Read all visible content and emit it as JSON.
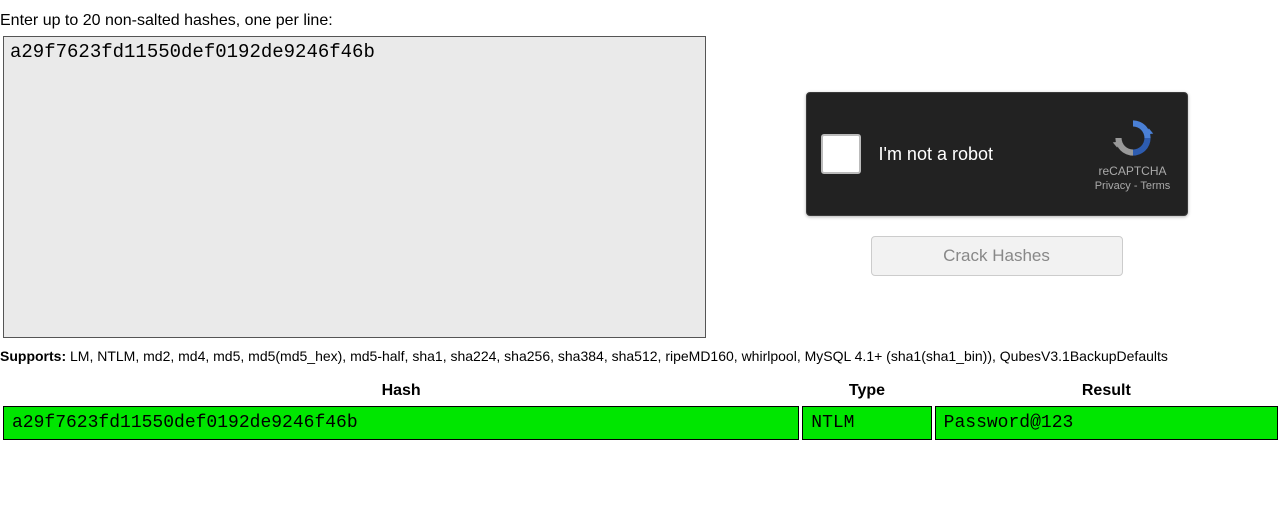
{
  "instruction": "Enter up to 20 non-salted hashes, one per line:",
  "textarea_value": "a29f7623fd11550def0192de9246f46b",
  "recaptcha": {
    "label": "I'm not a robot",
    "brand": "reCAPTCHA",
    "links": "Privacy - Terms"
  },
  "crack_button": "Crack Hashes",
  "supports_label": "Supports:",
  "supports_text": " LM, NTLM, md2, md4, md5, md5(md5_hex), md5-half, sha1, sha224, sha256, sha384, sha512, ripeMD160, whirlpool, MySQL 4.1+ (sha1(sha1_bin)), QubesV3.1BackupDefaults",
  "table": {
    "headers": {
      "hash": "Hash",
      "type": "Type",
      "result": "Result"
    },
    "row": {
      "hash": "a29f7623fd11550def0192de9246f46b",
      "type": "NTLM",
      "result": "Password@123"
    }
  }
}
